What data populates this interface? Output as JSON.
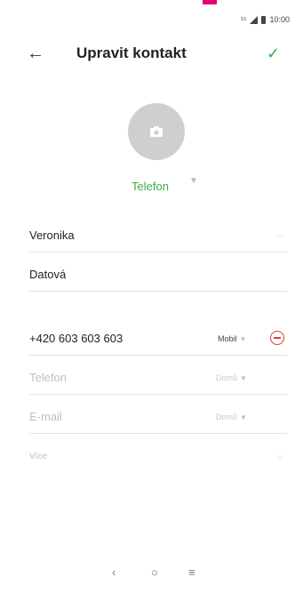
{
  "status_bar": {
    "network": "¹⁵",
    "time": "10:00"
  },
  "app_bar": {
    "back_icon": "arrow-left-icon",
    "title": "Upravit kontakt",
    "save_icon": "check-icon",
    "accent": "#3cab48"
  },
  "photo": {
    "icon": "camera-icon"
  },
  "account": {
    "label": "Telefon"
  },
  "fields": {
    "first_name": "Veronika",
    "last_name": "Datová",
    "phone": {
      "value": "+420 603 603 603",
      "type": "Mobil"
    },
    "new_phone": {
      "placeholder": "Telefon",
      "type": "Domů"
    },
    "email": {
      "placeholder": "E-mail",
      "type": "Domů"
    },
    "more": {
      "label": "Více"
    }
  },
  "nav": {
    "back": "‹",
    "home": "○",
    "recents": "≡"
  },
  "colors": {
    "accent_green": "#3cab48",
    "remove_red": "#e53935",
    "brand_magenta": "#e20074"
  }
}
